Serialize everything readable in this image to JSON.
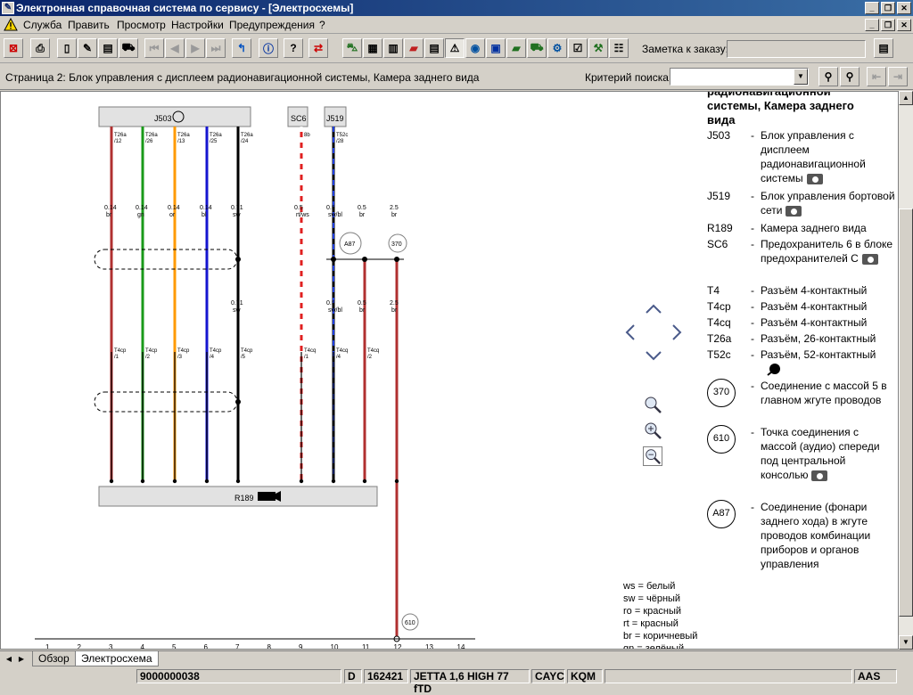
{
  "window": {
    "title": "Электронная справочная система по сервису - [Электросхемы]"
  },
  "menu": {
    "items": [
      "Служба",
      "Править",
      "Просмотр",
      "Настройки",
      "Предупреждения",
      "?"
    ]
  },
  "toolbar": {
    "order_note_label": "Заметка к заказу:",
    "order_note_value": ""
  },
  "infobar": {
    "page_title": "Страница 2: Блок управления с дисплеем радионавигационной системы, Камера заднего вида",
    "search_label": "Критерий поиска:",
    "search_value": ""
  },
  "legend": {
    "header_lines": [
      "радионавигационной",
      "системы, Камера заднего",
      "вида"
    ],
    "components": [
      {
        "code": "J503",
        "desc": "Блок управления с дисплеем радионавигационной системы",
        "photo": true
      },
      {
        "code": "J519",
        "desc": "Блок управления бортовой сети",
        "photo": true
      },
      {
        "code": "R189",
        "desc": "Камера заднего вида",
        "photo": false
      },
      {
        "code": "SC6",
        "desc": "Предохранитель 6 в блоке предохранителей С",
        "photo": true
      },
      {
        "code": "T4",
        "desc": "Разъём 4-контактный",
        "photo": false
      },
      {
        "code": "T4cp",
        "desc": "Разъём 4-контактный",
        "photo": false
      },
      {
        "code": "T4cq",
        "desc": "Разъём 4-контактный",
        "photo": false
      },
      {
        "code": "T26a",
        "desc": "Разъём, 26-контактный",
        "photo": false
      },
      {
        "code": "T52c",
        "desc": "Разъём, 52-контактный",
        "photo": false
      }
    ],
    "grounds": [
      {
        "code": "370",
        "desc": "Соединение с массой 5 в главном жгуте проводов",
        "photo": false
      },
      {
        "code": "610",
        "desc": "Точка соединения с массой (аудио) спереди под центральной консолью",
        "photo": true
      },
      {
        "code": "A87",
        "desc": "Соединение (фонари заднего хода) в жгуте проводов комбинации приборов и органов управления",
        "photo": false
      }
    ]
  },
  "colors": [
    "ws = белый",
    "sw = чёрный",
    "ro = красный",
    "rt = красный",
    "br = коричневый",
    "gn = зелёный"
  ],
  "schematic": {
    "top_blocks": [
      "J503",
      "SC6",
      "J519"
    ],
    "bottom_block": "R189",
    "wires": [
      {
        "pin": "T26a /12",
        "size": "0.14",
        "color": "br",
        "hex": "#b03030",
        "conn": "T4cp /1"
      },
      {
        "pin": "T26a /26",
        "size": "0.14",
        "color": "gn",
        "hex": "#1a9a1a",
        "conn": "T4cp /2"
      },
      {
        "pin": "T26a /13",
        "size": "0.14",
        "color": "or",
        "hex": "#ff9a00",
        "conn": "T4cp /3"
      },
      {
        "pin": "T26a /25",
        "size": "0.14",
        "color": "bl",
        "hex": "#1515d0",
        "conn": "T4cp /4"
      },
      {
        "pin": "T26a /24",
        "size": "0.71",
        "color": "sw",
        "hex": "#000000",
        "conn": "T4cp /5"
      },
      {
        "pin": "8b",
        "size": "0.5",
        "color": "rt/ws",
        "hex": "#e02020",
        "conn": "T4cq /1"
      },
      {
        "pin": "T52c /28",
        "size": "0.5",
        "color": "sw/bl",
        "hex": "#000000",
        "conn": "T4cq /4"
      },
      {
        "pin": "",
        "size": "0.5",
        "color": "br",
        "hex": "#b03030",
        "conn": "T4cq /2"
      },
      {
        "pin": "",
        "size": "2.5",
        "color": "br",
        "hex": "#b03030",
        "conn": ""
      }
    ],
    "second_size": {
      "w5": "0.71",
      "w5c": "sw",
      "w7": "0.5",
      "w7c": "sw/bl"
    },
    "grounds": [
      "A87",
      "370",
      "610"
    ],
    "ruler": [
      "1",
      "2",
      "3",
      "4",
      "5",
      "6",
      "7",
      "8",
      "9",
      "10",
      "11",
      "12",
      "13",
      "14"
    ]
  },
  "tabs": [
    "Обзор",
    "Электросхема"
  ],
  "status": [
    "9000000038",
    "D",
    "162421",
    "JETTA 1,6 HIGH 77 fTD",
    "CAYC",
    "KQM",
    "AAS"
  ]
}
